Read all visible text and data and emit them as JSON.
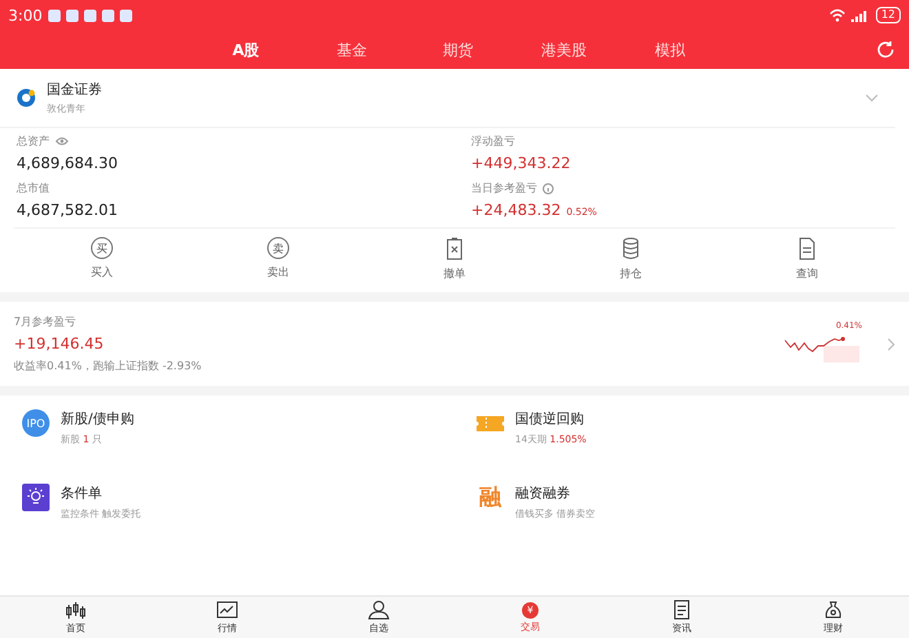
{
  "status_bar": {
    "time": "3:00",
    "battery": "12"
  },
  "tabs": [
    {
      "label": "A股",
      "selected": true
    },
    {
      "label": "基金",
      "selected": false
    },
    {
      "label": "期货",
      "selected": false
    },
    {
      "label": "港美股",
      "selected": false
    },
    {
      "label": "模拟",
      "selected": false
    }
  ],
  "account": {
    "broker": "国金证券",
    "branch": "敦化青年"
  },
  "metrics": [
    {
      "kind": "plain",
      "label": "总资产",
      "visibility_toggle": true,
      "value": "4,689,684.30"
    },
    {
      "kind": "gain",
      "label": "浮动盈亏",
      "value": "+449,343.22"
    },
    {
      "kind": "plain",
      "label": "总市值",
      "value": "4,687,582.01"
    },
    {
      "kind": "gain",
      "label": "当日参考盈亏",
      "info_hint": true,
      "value": "+24,483.32",
      "change": "0.52%"
    }
  ],
  "actions": [
    {
      "kind": "glyph",
      "glyph": "买",
      "label": "买入"
    },
    {
      "kind": "glyph",
      "glyph": "卖",
      "label": "卖出"
    },
    {
      "kind": "cancel",
      "label": "撤单"
    },
    {
      "kind": "holdings",
      "label": "持仓"
    },
    {
      "kind": "query",
      "label": "查询"
    }
  ],
  "monthly": {
    "title": "7月参考盈亏",
    "value": "+19,146.45",
    "note": "收益率0.41%，跑输上证指数 -2.93%",
    "sparkline_label": "0.41%"
  },
  "services": [
    {
      "kind": "ipo",
      "glyph": "IPO",
      "title": "新股/债申购",
      "subtitle": [
        {
          "text": "新股 ",
          "accent": false
        },
        {
          "text": "1",
          "accent": true
        },
        {
          "text": " 只",
          "accent": false
        }
      ]
    },
    {
      "kind": "ticket",
      "title": "国债逆回购",
      "subtitle": [
        {
          "text": "14天期 ",
          "accent": false
        },
        {
          "text": "1.505%",
          "accent": true
        }
      ]
    },
    {
      "kind": "bulb",
      "title": "条件单",
      "subtitle": [
        {
          "text": "监控条件 触发委托",
          "accent": false
        }
      ]
    },
    {
      "kind": "char",
      "glyph": "融",
      "title": "融资融券",
      "subtitle": [
        {
          "text": "借钱买多 借券卖空",
          "accent": false
        }
      ]
    }
  ],
  "bottom_nav": [
    {
      "kind": "home",
      "label": "首页",
      "selected": false
    },
    {
      "kind": "chart",
      "label": "行情",
      "selected": false
    },
    {
      "kind": "person",
      "label": "自选",
      "selected": false
    },
    {
      "kind": "trade",
      "glyph": "¥",
      "label": "交易",
      "selected": true
    },
    {
      "kind": "news",
      "label": "资讯",
      "selected": false
    },
    {
      "kind": "bag",
      "label": "理财",
      "selected": false
    }
  ]
}
